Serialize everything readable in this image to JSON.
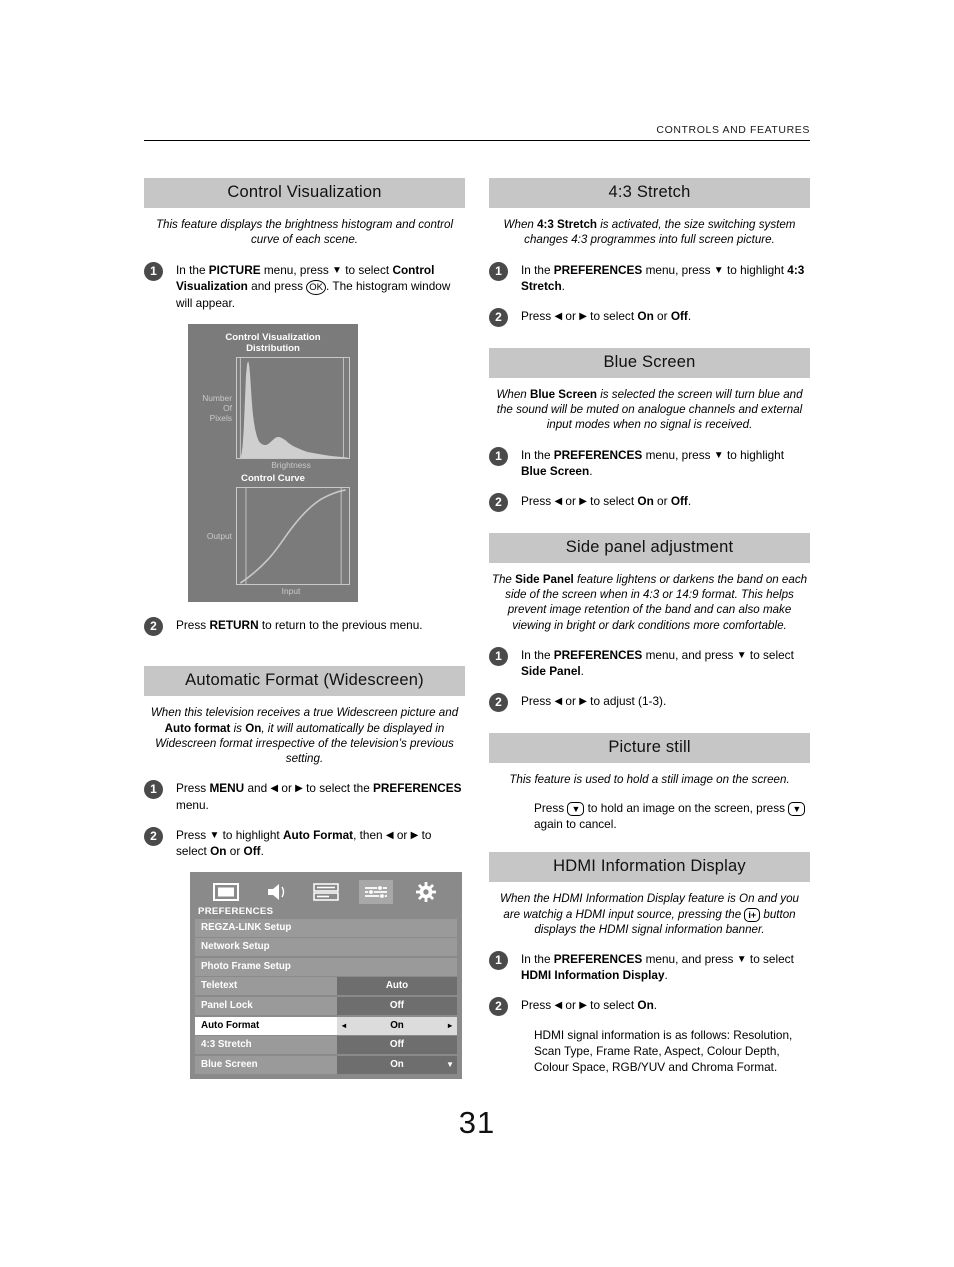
{
  "header": {
    "running_head": "CONTROLS AND FEATURES"
  },
  "page_number": "31",
  "left_column": {
    "sections": [
      {
        "title": "Control Visualization",
        "intro": "This feature displays the brightness histogram and control curve of each scene.",
        "step1_num": "1",
        "step1_text_a": "In the ",
        "step1_bold_a": "PICTURE",
        "step1_text_b": " menu, press ",
        "step1_arrow": "▼",
        "step1_text_c": " to select ",
        "step1_bold_b": "Control Visualization",
        "step1_text_d": " and press ",
        "step1_key": "OK",
        "step1_text_e": ". The histogram window will appear.",
        "step2_num": "2",
        "step2_text_a": "Press ",
        "step2_bold_a": "RETURN",
        "step2_text_b": " to return to the previous menu."
      },
      {
        "title": "Automatic Format (Widescreen)",
        "intro_a": "When this television receives a true Widescreen picture and ",
        "intro_bold_a": "Auto format",
        "intro_b": " is ",
        "intro_bold_b": "On",
        "intro_c": ", it will automatically be displayed in Widescreen format irrespective of the television’s previous setting.",
        "step1_num": "1",
        "step1_text_a": "Press ",
        "step1_bold_a": "MENU",
        "step1_text_b": " and ",
        "step1_arrow_l": "◀",
        "step1_text_c": " or ",
        "step1_arrow_r": "▶",
        "step1_text_d": " to select the ",
        "step1_bold_b": "PREFERENCES",
        "step1_text_e": " menu.",
        "step2_num": "2",
        "step2_text_a": "Press ",
        "step2_arrow_d": "▼",
        "step2_text_b": " to highlight ",
        "step2_bold_a": "Auto Format",
        "step2_text_c": ", then ",
        "step2_arrow_l": "◀",
        "step2_text_d": " or ",
        "step2_arrow_r": "▶",
        "step2_text_e": " to select ",
        "step2_bold_b": "On",
        "step2_text_f": " or ",
        "step2_bold_c": "Off",
        "step2_text_g": "."
      }
    ]
  },
  "control_visualization_figure": {
    "title_line1": "Control Visualization",
    "title_line2": "Distribution",
    "histogram_ylabel": "Number\nOf\nPixels",
    "histogram_ylabel_l1": "Number",
    "histogram_ylabel_l2": "Of",
    "histogram_ylabel_l3": "Pixels",
    "histogram_xlabel": "Brightness",
    "curve_title": "Control Curve",
    "curve_ylabel": "Output",
    "curve_xlabel": "Input",
    "bg_color": "#7b7b7b",
    "plot_line_color": "#c9c9c9",
    "fill_color": "#cfcfcf"
  },
  "osd_menu": {
    "menu_title": "PREFERENCES",
    "icons": [
      {
        "name": "picture-icon",
        "selected": false
      },
      {
        "name": "sound-icon",
        "selected": false
      },
      {
        "name": "setup-icon",
        "selected": false
      },
      {
        "name": "preferences-icon",
        "selected": true
      },
      {
        "name": "gear-icon",
        "selected": false
      }
    ],
    "rows": [
      {
        "label": "REGZA-LINK Setup",
        "value": "",
        "highlight": false,
        "full": true
      },
      {
        "label": "Network Setup",
        "value": "",
        "highlight": false,
        "full": true
      },
      {
        "label": "Photo Frame Setup",
        "value": "",
        "highlight": false,
        "full": true
      },
      {
        "label": "Teletext",
        "value": "Auto",
        "highlight": false,
        "full": false
      },
      {
        "label": "Panel Lock",
        "value": "Off",
        "highlight": false,
        "full": false
      },
      {
        "label": "Auto Format",
        "value": "On",
        "highlight": true,
        "full": false
      },
      {
        "label": "4:3 Stretch",
        "value": "Off",
        "highlight": false,
        "full": false
      },
      {
        "label": "Blue Screen",
        "value": "On",
        "highlight": false,
        "full": false
      }
    ],
    "left_arrow": "◂",
    "right_arrow": "▸",
    "scroll_down_arrow": "▼"
  },
  "right_column": {
    "s43": {
      "title": "4:3 Stretch",
      "intro_a": "When ",
      "intro_bold_a": "4:3 Stretch",
      "intro_b": " is activated, the size switching system changes 4:3 programmes into full screen picture.",
      "step1_num": "1",
      "step1_text_a": "In the ",
      "step1_bold_a": "PREFERENCES",
      "step1_text_b": " menu, press ",
      "step1_arrow": "▼",
      "step1_text_c": " to highlight ",
      "step1_bold_b": "4:3 Stretch",
      "step1_text_d": ".",
      "step2_num": "2",
      "step2_text_a": "Press ",
      "step2_arrow_l": "◀",
      "step2_text_b": " or ",
      "step2_arrow_r": "▶",
      "step2_text_c": " to select ",
      "step2_bold_a": "On",
      "step2_text_d": " or ",
      "step2_bold_b": "Off",
      "step2_text_e": "."
    },
    "blue_screen": {
      "title": "Blue Screen",
      "intro_a": "When ",
      "intro_bold_a": "Blue Screen",
      "intro_b": " is selected the screen will turn blue and the sound will be muted on analogue channels and external input modes when no signal is received.",
      "step1_num": "1",
      "step1_text_a": "In the ",
      "step1_bold_a": "PREFERENCES",
      "step1_text_b": " menu, press ",
      "step1_arrow": "▼",
      "step1_text_c": " to highlight ",
      "step1_bold_b": "Blue Screen",
      "step1_text_d": ".",
      "step2_num": "2",
      "step2_text_a": "Press ",
      "step2_arrow_l": "◀",
      "step2_text_b": " or ",
      "step2_arrow_r": "▶",
      "step2_text_c": " to select ",
      "step2_bold_a": "On",
      "step2_text_d": " or ",
      "step2_bold_b": "Off",
      "step2_text_e": "."
    },
    "side_panel": {
      "title": "Side panel adjustment",
      "intro_a": "The ",
      "intro_bold_a": "Side Panel",
      "intro_b": " feature lightens or darkens the band on each side of the screen when in 4:3 or 14:9 format. This helps prevent image retention of the band and can also make viewing in bright or dark conditions more comfortable.",
      "step1_num": "1",
      "step1_text_a": "In the ",
      "step1_bold_a": "PREFERENCES",
      "step1_text_b": " menu, and press ",
      "step1_arrow": "▼",
      "step1_text_c": " to select ",
      "step1_bold_b": "Side Panel",
      "step1_text_d": ".",
      "step2_num": "2",
      "step2_text_a": "Press ",
      "step2_arrow_l": "◀",
      "step2_text_b": " or ",
      "step2_arrow_r": "▶",
      "step2_text_c": " to adjust (1-3)."
    },
    "picture_still": {
      "title": "Picture still",
      "intro": "This feature is used to hold a still image on the screen.",
      "body_a": "Press ",
      "key_a": "▼",
      "body_b": " to hold an image on the screen, press ",
      "key_b": "▼",
      "body_c": " again to cancel."
    },
    "hdmi": {
      "title": "HDMI Information Display",
      "intro_a": "When the HDMI Information Display feature is On and you are watchig a HDMI input source, pressing the ",
      "intro_key": "i+",
      "intro_b": " button displays the HDMI signal information banner.",
      "step1_num": "1",
      "step1_text_a": "In the ",
      "step1_bold_a": "PREFERENCES",
      "step1_text_b": " menu, and press ",
      "step1_arrow": "▼",
      "step1_text_c": " to select ",
      "step1_bold_b": "HDMI Information Display",
      "step1_text_d": ".",
      "step2_num": "2",
      "step2_text_a": "Press ",
      "step2_arrow_l": "◀",
      "step2_text_b": " or ",
      "step2_arrow_r": "▶",
      "step2_text_c": " to select ",
      "step2_bold_a": "On",
      "step2_text_d": ".",
      "step2_para": "HDMI signal information is as follows: Resolution, Scan Type, Frame Rate, Aspect, Colour Depth, Colour Space, RGB/YUV and Chroma Format."
    }
  }
}
